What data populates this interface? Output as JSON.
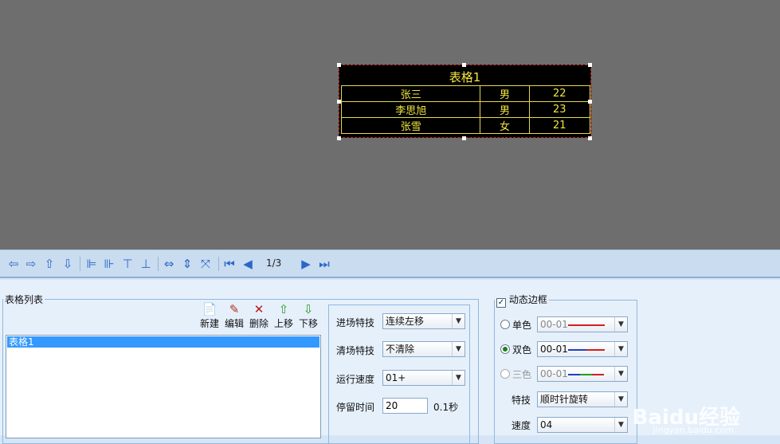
{
  "led": {
    "title": "表格1",
    "rows": [
      [
        "张三",
        "男",
        "22"
      ],
      [
        "李思旭",
        "男",
        "23"
      ],
      [
        "张雪",
        "女",
        "21"
      ]
    ]
  },
  "toolbar": {
    "icons": [
      "move-left-icon",
      "move-right-icon",
      "move-up-icon",
      "move-down-icon",
      "align-left-icon",
      "align-right-icon",
      "align-top-icon",
      "align-bottom-icon",
      "same-width-icon",
      "same-height-icon",
      "fit-screen-icon",
      "first-page-icon",
      "prev-page-icon",
      "next-page-icon",
      "last-page-icon"
    ],
    "page": "1/3"
  },
  "table_list": {
    "legend": "表格列表",
    "new_label": "新建",
    "edit_label": "编辑",
    "delete_label": "删除",
    "up_label": "上移",
    "down_label": "下移",
    "items": [
      "表格1"
    ]
  },
  "effects": {
    "enter_label": "进场特技",
    "enter_value": "连续左移",
    "clear_label": "清场特技",
    "clear_value": "不清除",
    "speed_label": "运行速度",
    "speed_value": "01+",
    "stay_label": "停留时间",
    "stay_value": "20",
    "stay_unit": "0.1秒"
  },
  "border": {
    "legend": "动态边框",
    "checked": true,
    "single_label": "单色",
    "single_value": "00-01",
    "double_label": "双色",
    "double_value": "00-01",
    "triple_label": "三色",
    "triple_value": "00-01",
    "effect_label": "特技",
    "effect_value": "顺时针旋转",
    "speed_label": "速度",
    "speed_value": "04",
    "selected": "double",
    "colors": {
      "single": "#d02020",
      "double_a": "#2040c0",
      "double_b": "#d02020",
      "triple_a": "#2040c0",
      "triple_b": "#20a020",
      "triple_c": "#d02020"
    }
  },
  "watermark": {
    "brand": "Baidu经验",
    "url": "jingyan.baidu.com"
  }
}
